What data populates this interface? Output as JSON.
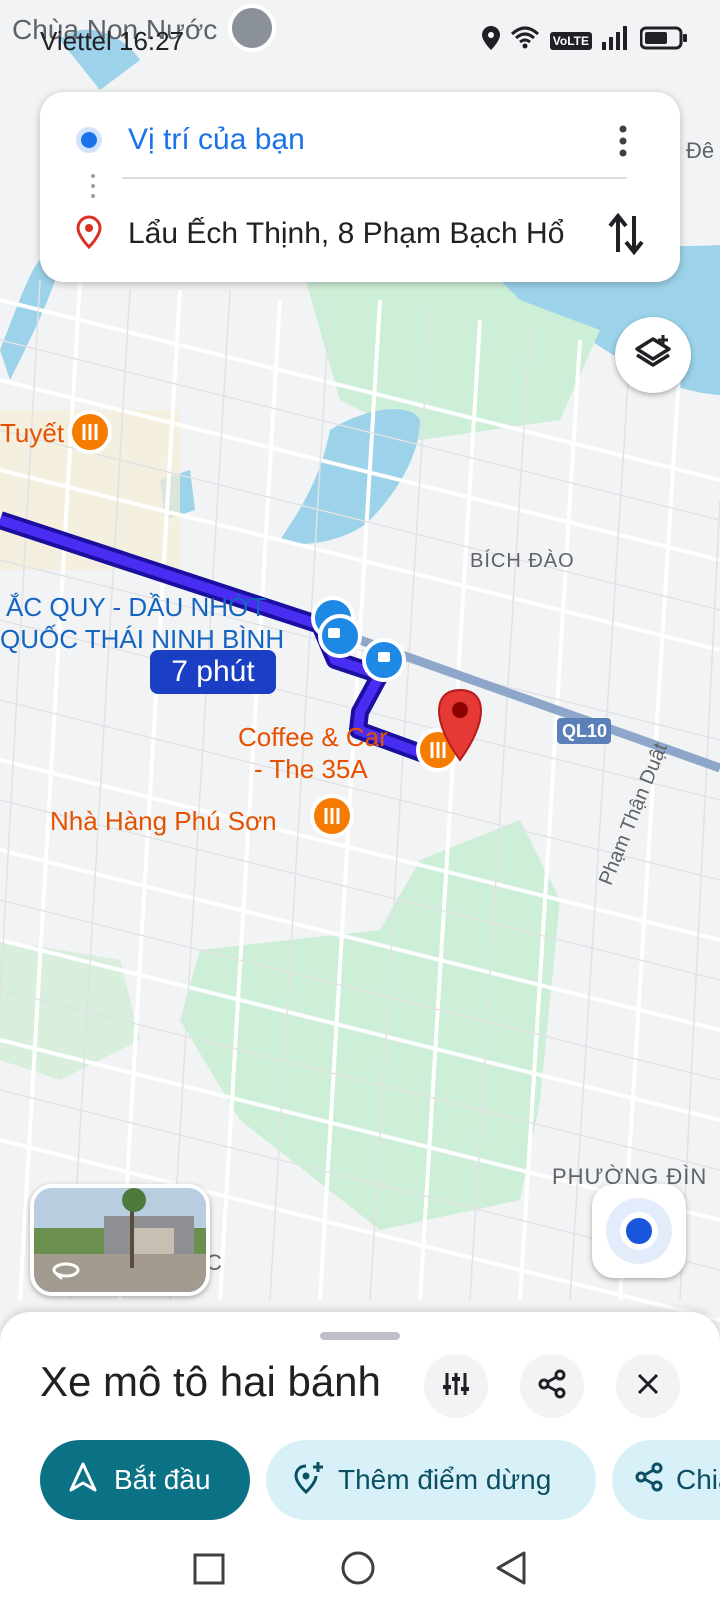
{
  "status_bar": {
    "carrier_time": "Viettel 16:27",
    "network": "VoLTE"
  },
  "map_labels": {
    "pagoda": "Chùa Non Nước",
    "de": "Đê",
    "tuyet": "Tuyết",
    "bich_dao": "BÍCH ĐÀO",
    "shop_line1": "ẮC QUY - DẦU NHỚT",
    "shop_line2": "QUỐC THÁI NINH BÌNH",
    "coffee_line1": "Coffee & Car",
    "coffee_line2": "- The 35A",
    "restaurant": "Nhà Hàng Phú Sơn",
    "highway": "QL10",
    "street": "Phạm Thận Duật",
    "phuong_dinh": "PHƯỜNG ĐÌN",
    "c_suffix": "C"
  },
  "route_card": {
    "origin": "Vị trí của bạn",
    "destination": "Lẩu Ếch Thịnh, 8 Phạm Bạch Hổ"
  },
  "route_time": "7 phút",
  "bottom_sheet": {
    "mode": "Xe mô tô hai bánh",
    "start": "Bắt đầu",
    "add_stop": "Thêm điểm dừng",
    "share": "Chia sẻ"
  },
  "icons": [
    "location-icon",
    "wifi-icon",
    "signal-icon",
    "battery-icon",
    "more-icon",
    "swap-icon",
    "layers-icon",
    "my-location-icon",
    "filter-icon",
    "share-icon",
    "close-icon",
    "navigation-icon",
    "add-stop-icon",
    "back-icon",
    "home-icon",
    "recents-icon"
  ]
}
